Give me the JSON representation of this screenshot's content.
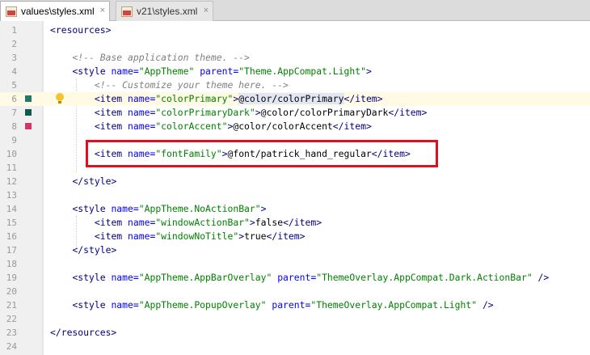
{
  "tabs": [
    {
      "label": "values\\styles.xml",
      "active": true,
      "icon": "xml-file-icon"
    },
    {
      "label": "v21\\styles.xml",
      "active": false,
      "icon": "xml-file-icon"
    }
  ],
  "tab_close_glyph": "×",
  "colors": {
    "colorPrimary": "#1f7a6a",
    "colorPrimaryDark": "#0f5a4f",
    "colorAccent": "#d6336c",
    "highlight_box": "#e2101f"
  },
  "lines": [
    {
      "n": "1",
      "parts": [
        [
          "tag",
          "<resources>"
        ]
      ]
    },
    {
      "n": "2",
      "parts": []
    },
    {
      "n": "3",
      "parts": [
        [
          "sp",
          "    "
        ],
        [
          "cmt",
          "<!-- Base application theme. -->"
        ]
      ]
    },
    {
      "n": "4",
      "parts": [
        [
          "sp",
          "    "
        ],
        [
          "tag",
          "<style "
        ],
        [
          "attr",
          "name="
        ],
        [
          "val",
          "\"AppTheme\" "
        ],
        [
          "attr",
          "parent="
        ],
        [
          "val",
          "\"Theme.AppCompat.Light\""
        ],
        [
          "tag",
          ">"
        ]
      ]
    },
    {
      "n": "5",
      "parts": [
        [
          "sp",
          "        "
        ],
        [
          "cmt",
          "<!-- Customize your theme here. -->"
        ]
      ]
    },
    {
      "n": "6",
      "parts": [
        [
          "sp",
          "        "
        ],
        [
          "tag",
          "<item "
        ],
        [
          "attr",
          "name="
        ],
        [
          "val",
          "\"colorPrimary\""
        ],
        [
          "tag",
          ">"
        ],
        [
          "sel",
          "@colo"
        ],
        [
          "caret",
          ""
        ],
        [
          "sel",
          "r/colorPrimary"
        ],
        [
          "tag",
          "</item>"
        ]
      ]
    },
    {
      "n": "7",
      "parts": [
        [
          "sp",
          "        "
        ],
        [
          "tag",
          "<item "
        ],
        [
          "attr",
          "name="
        ],
        [
          "val",
          "\"colorPrimaryDark\""
        ],
        [
          "tag",
          ">"
        ],
        [
          "text",
          "@color/colorPrimaryDark"
        ],
        [
          "tag",
          "</item>"
        ]
      ]
    },
    {
      "n": "8",
      "parts": [
        [
          "sp",
          "        "
        ],
        [
          "tag",
          "<item "
        ],
        [
          "attr",
          "name="
        ],
        [
          "val",
          "\"colorAccent\""
        ],
        [
          "tag",
          ">"
        ],
        [
          "text",
          "@color/colorAccent"
        ],
        [
          "tag",
          "</item>"
        ]
      ]
    },
    {
      "n": "9",
      "parts": []
    },
    {
      "n": "10",
      "parts": [
        [
          "sp",
          "        "
        ],
        [
          "tag",
          "<item "
        ],
        [
          "attr",
          "name="
        ],
        [
          "val",
          "\"fontFamily\""
        ],
        [
          "tag",
          ">"
        ],
        [
          "text",
          "@font/patrick_hand_regular"
        ],
        [
          "tag",
          "</item>"
        ]
      ]
    },
    {
      "n": "11",
      "parts": []
    },
    {
      "n": "12",
      "parts": [
        [
          "sp",
          "    "
        ],
        [
          "tag",
          "</style>"
        ]
      ]
    },
    {
      "n": "13",
      "parts": []
    },
    {
      "n": "14",
      "parts": [
        [
          "sp",
          "    "
        ],
        [
          "tag",
          "<style "
        ],
        [
          "attr",
          "name="
        ],
        [
          "val",
          "\"AppTheme.NoActionBar\""
        ],
        [
          "tag",
          ">"
        ]
      ]
    },
    {
      "n": "15",
      "parts": [
        [
          "sp",
          "        "
        ],
        [
          "tag",
          "<item "
        ],
        [
          "attr",
          "name="
        ],
        [
          "val",
          "\"windowActionBar\""
        ],
        [
          "tag",
          ">"
        ],
        [
          "text",
          "false"
        ],
        [
          "tag",
          "</item>"
        ]
      ]
    },
    {
      "n": "16",
      "parts": [
        [
          "sp",
          "        "
        ],
        [
          "tag",
          "<item "
        ],
        [
          "attr",
          "name="
        ],
        [
          "val",
          "\"windowNoTitle\""
        ],
        [
          "tag",
          ">"
        ],
        [
          "text",
          "true"
        ],
        [
          "tag",
          "</item>"
        ]
      ]
    },
    {
      "n": "17",
      "parts": [
        [
          "sp",
          "    "
        ],
        [
          "tag",
          "</style>"
        ]
      ]
    },
    {
      "n": "18",
      "parts": []
    },
    {
      "n": "19",
      "parts": [
        [
          "sp",
          "    "
        ],
        [
          "tag",
          "<style "
        ],
        [
          "attr",
          "name="
        ],
        [
          "val",
          "\"AppTheme.AppBarOverlay\" "
        ],
        [
          "attr",
          "parent="
        ],
        [
          "val",
          "\"ThemeOverlay.AppCompat.Dark.ActionBar\" "
        ],
        [
          "tag",
          "/>"
        ]
      ]
    },
    {
      "n": "20",
      "parts": []
    },
    {
      "n": "21",
      "parts": [
        [
          "sp",
          "    "
        ],
        [
          "tag",
          "<style "
        ],
        [
          "attr",
          "name="
        ],
        [
          "val",
          "\"AppTheme.PopupOverlay\" "
        ],
        [
          "attr",
          "parent="
        ],
        [
          "val",
          "\"ThemeOverlay.AppCompat.Light\" "
        ],
        [
          "tag",
          "/>"
        ]
      ]
    },
    {
      "n": "22",
      "parts": []
    },
    {
      "n": "23",
      "parts": [
        [
          "tag",
          "</resources>"
        ]
      ]
    },
    {
      "n": "24",
      "parts": []
    }
  ]
}
